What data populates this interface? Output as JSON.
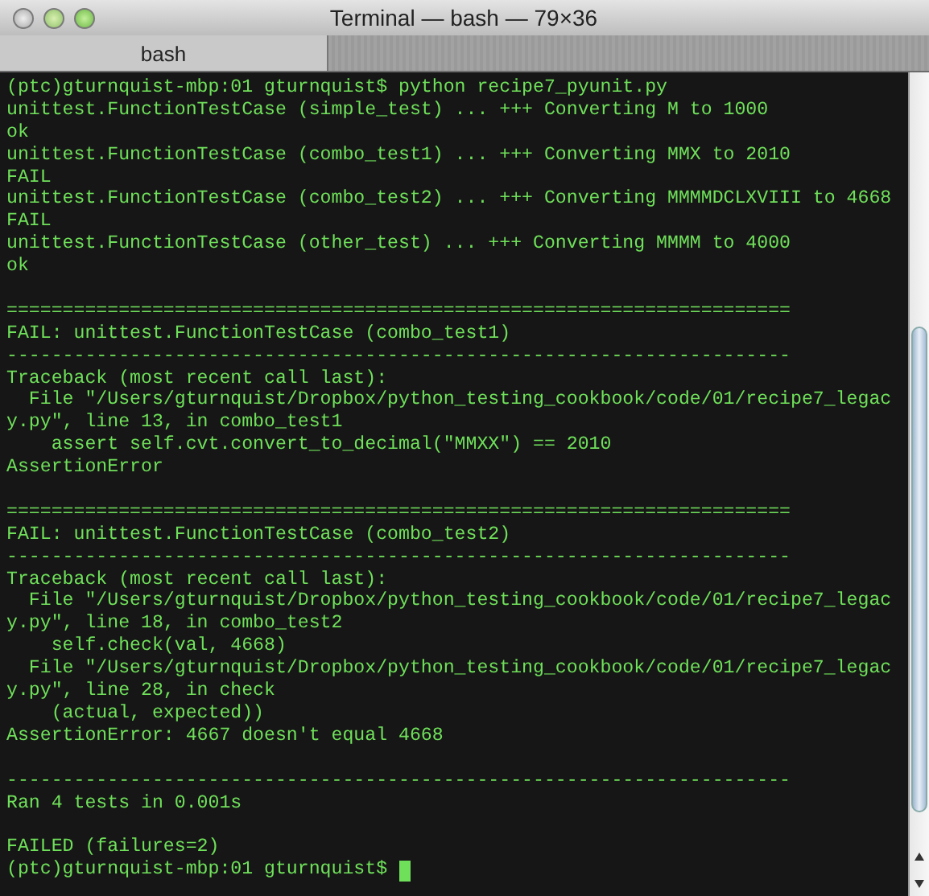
{
  "window": {
    "title": "Terminal — bash — 79×36"
  },
  "tabs": [
    {
      "label": "bash",
      "selected": true
    }
  ],
  "lines": [
    {
      "kind": "text",
      "text": "(ptc)gturnquist-mbp:01 gturnquist$ python recipe7_pyunit.py"
    },
    {
      "kind": "text",
      "text": "unittest.FunctionTestCase (simple_test) ... +++ Converting M to 1000"
    },
    {
      "kind": "text",
      "text": "ok"
    },
    {
      "kind": "text",
      "text": "unittest.FunctionTestCase (combo_test1) ... +++ Converting MMX to 2010"
    },
    {
      "kind": "text",
      "text": "FAIL"
    },
    {
      "kind": "text",
      "text": "unittest.FunctionTestCase (combo_test2) ... +++ Converting MMMMDCLXVIII to 4668"
    },
    {
      "kind": "text",
      "text": "FAIL"
    },
    {
      "kind": "text",
      "text": "unittest.FunctionTestCase (other_test) ... +++ Converting MMMM to 4000"
    },
    {
      "kind": "text",
      "text": "ok"
    },
    {
      "kind": "blank"
    },
    {
      "kind": "text",
      "text": "======================================================================"
    },
    {
      "kind": "text",
      "text": "FAIL: unittest.FunctionTestCase (combo_test1)"
    },
    {
      "kind": "text",
      "text": "----------------------------------------------------------------------"
    },
    {
      "kind": "text",
      "text": "Traceback (most recent call last):"
    },
    {
      "kind": "text",
      "text": "  File \"/Users/gturnquist/Dropbox/python_testing_cookbook/code/01/recipe7_legac"
    },
    {
      "kind": "text",
      "text": "y.py\", line 13, in combo_test1"
    },
    {
      "kind": "text",
      "text": "    assert self.cvt.convert_to_decimal(\"MMXX\") == 2010"
    },
    {
      "kind": "text",
      "text": "AssertionError"
    },
    {
      "kind": "blank"
    },
    {
      "kind": "text",
      "text": "======================================================================"
    },
    {
      "kind": "text",
      "text": "FAIL: unittest.FunctionTestCase (combo_test2)"
    },
    {
      "kind": "text",
      "text": "----------------------------------------------------------------------"
    },
    {
      "kind": "text",
      "text": "Traceback (most recent call last):"
    },
    {
      "kind": "text",
      "text": "  File \"/Users/gturnquist/Dropbox/python_testing_cookbook/code/01/recipe7_legac"
    },
    {
      "kind": "text",
      "text": "y.py\", line 18, in combo_test2"
    },
    {
      "kind": "text",
      "text": "    self.check(val, 4668)"
    },
    {
      "kind": "text",
      "text": "  File \"/Users/gturnquist/Dropbox/python_testing_cookbook/code/01/recipe7_legac"
    },
    {
      "kind": "text",
      "text": "y.py\", line 28, in check"
    },
    {
      "kind": "text",
      "text": "    (actual, expected))"
    },
    {
      "kind": "text",
      "text": "AssertionError: 4667 doesn't equal 4668"
    },
    {
      "kind": "blank"
    },
    {
      "kind": "text",
      "text": "----------------------------------------------------------------------"
    },
    {
      "kind": "text",
      "text": "Ran 4 tests in 0.001s"
    },
    {
      "kind": "blank"
    },
    {
      "kind": "text",
      "text": "FAILED (failures=2)"
    },
    {
      "kind": "prompt",
      "text": "(ptc)gturnquist-mbp:01 gturnquist$",
      "cursor": true
    }
  ]
}
